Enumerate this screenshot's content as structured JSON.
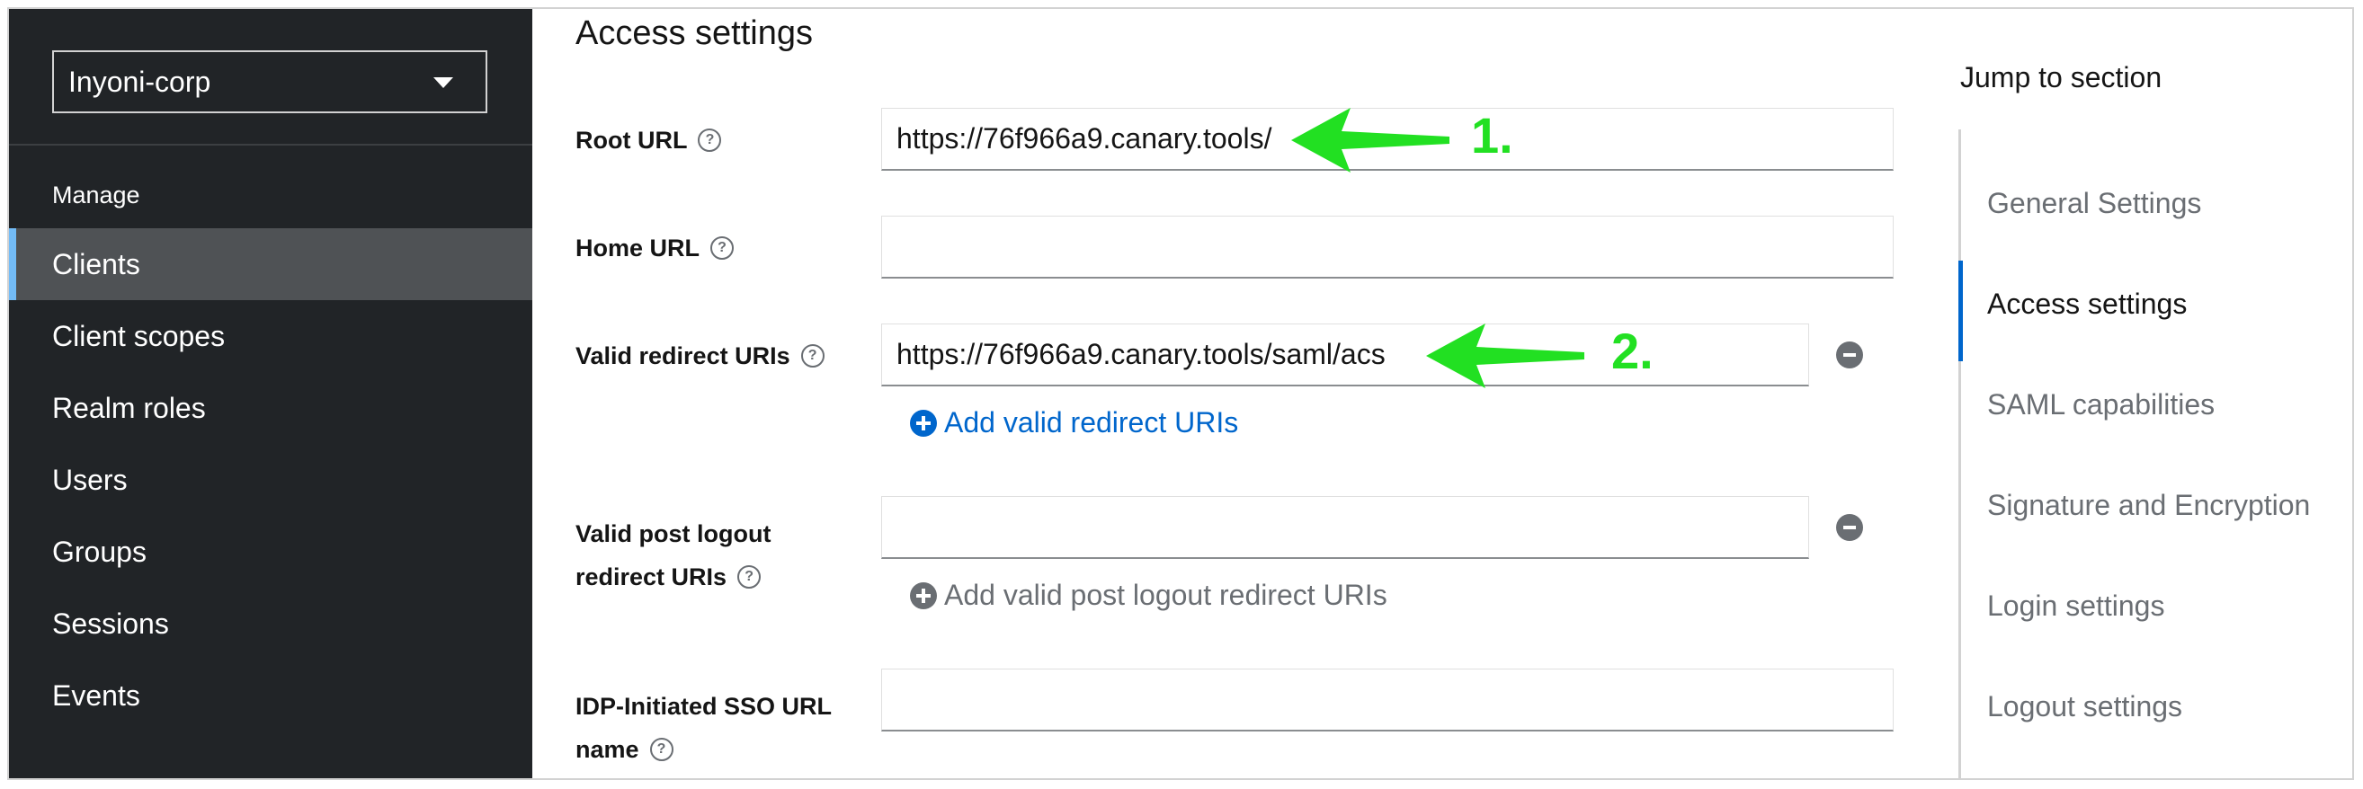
{
  "sidebar": {
    "realm": "Inyoni-corp",
    "section": "Manage",
    "items": [
      {
        "label": "Clients",
        "active": true
      },
      {
        "label": "Client scopes",
        "active": false
      },
      {
        "label": "Realm roles",
        "active": false
      },
      {
        "label": "Users",
        "active": false
      },
      {
        "label": "Groups",
        "active": false
      },
      {
        "label": "Sessions",
        "active": false
      },
      {
        "label": "Events",
        "active": false
      }
    ]
  },
  "main": {
    "title": "Access settings",
    "fields": {
      "root_url": {
        "label": "Root URL",
        "value": "https://76f966a9.canary.tools/"
      },
      "home_url": {
        "label": "Home URL",
        "value": ""
      },
      "redirect_uris": {
        "label": "Valid redirect URIs",
        "value": "https://76f966a9.canary.tools/saml/acs",
        "add_label": "Add valid redirect URIs"
      },
      "post_logout": {
        "label_line1": "Valid post logout",
        "label_line2": "redirect URIs",
        "value": "",
        "add_label": "Add valid post logout redirect URIs"
      },
      "idp_sso": {
        "label_line1": "IDP-Initiated SSO URL",
        "label_line2": "name",
        "value": ""
      }
    },
    "annotations": [
      "1.",
      "2."
    ]
  },
  "jump": {
    "title": "Jump to section",
    "items": [
      {
        "label": "General Settings",
        "active": false
      },
      {
        "label": "Access settings",
        "active": true
      },
      {
        "label": "SAML capabilities",
        "active": false
      },
      {
        "label": "Signature and Encryption",
        "active": false
      },
      {
        "label": "Login settings",
        "active": false
      },
      {
        "label": "Logout settings",
        "active": false
      }
    ]
  },
  "colors": {
    "sidebar_bg": "#212427",
    "active_item_bg": "#4f5255",
    "active_accent": "#73bcf7",
    "link_blue": "#0066cc",
    "annotation_green": "#22e022"
  }
}
